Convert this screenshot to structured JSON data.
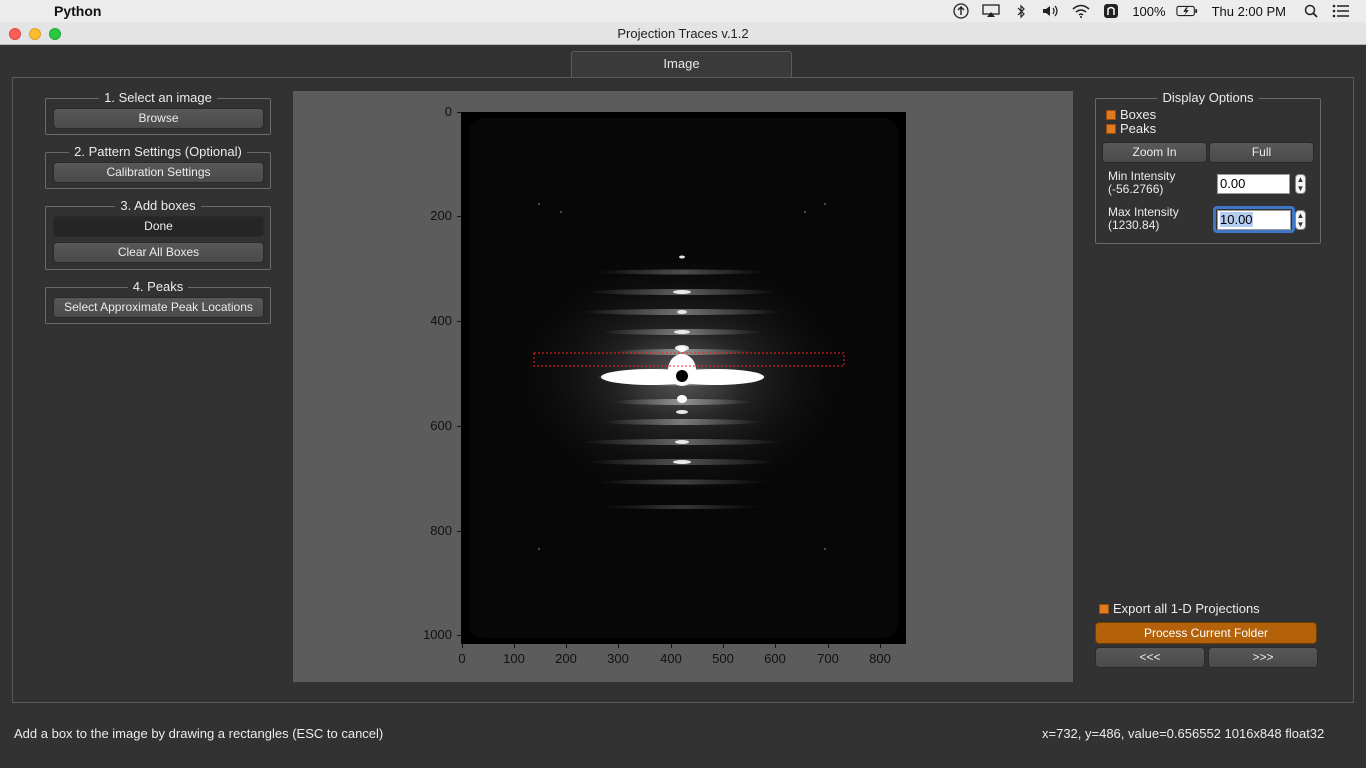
{
  "menubar": {
    "app_name": "Python",
    "battery": "100%",
    "clock": "Thu 2:00 PM"
  },
  "window": {
    "title": "Projection Traces v.1.2"
  },
  "tabs": [
    {
      "label": "Image"
    }
  ],
  "left_panel": {
    "step1": {
      "title": "1. Select an image",
      "browse_label": "Browse"
    },
    "step2": {
      "title": "2. Pattern Settings (Optional)",
      "calibration_label": "Calibration Settings"
    },
    "step3": {
      "title": "3. Add boxes",
      "done_label": "Done",
      "clear_label": "Clear All Boxes"
    },
    "step4": {
      "title": "4. Peaks",
      "select_peaks_label": "Select Approximate Peak Locations"
    }
  },
  "plot": {
    "y_ticks": [
      "0",
      "200",
      "400",
      "600",
      "800",
      "1000"
    ],
    "x_ticks": [
      "0",
      "100",
      "200",
      "300",
      "400",
      "500",
      "600",
      "700",
      "800"
    ],
    "selection_box_color": "#ff2020"
  },
  "display_options": {
    "title": "Display Options",
    "boxes_label": "Boxes",
    "boxes_checked": true,
    "peaks_label": "Peaks",
    "peaks_checked": true,
    "zoom_in_label": "Zoom In",
    "full_label": "Full",
    "min_intensity_label": "Min Intensity",
    "min_intensity_range": "(-56.2766)",
    "min_intensity_value": "0.00",
    "max_intensity_label": "Max Intensity",
    "max_intensity_range": "(1230.84)",
    "max_intensity_value": "10.00"
  },
  "export": {
    "export_label": "Export all 1-D Projections",
    "export_checked": true,
    "process_label": "Process Current Folder",
    "prev_label": "<<<",
    "next_label": ">>>"
  },
  "status": {
    "message": "Add a box to the image by drawing a rectangles (ESC to cancel)",
    "coords": "x=732, y=486, value=0.656552  1016x848 float32"
  },
  "colors": {
    "accent": "#e07a1f",
    "process_button": "#b4620a"
  }
}
